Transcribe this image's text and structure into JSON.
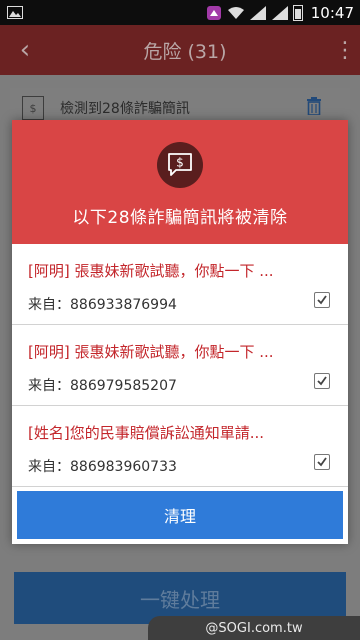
{
  "status_bar": {
    "time": "10:47",
    "icons": [
      "image-icon",
      "notification-icon",
      "wifi-icon",
      "signal-icon",
      "signal-icon",
      "battery-icon"
    ]
  },
  "app_bar": {
    "back_icon": "‹",
    "title": "危险 (31)",
    "more_icon": "⋮"
  },
  "background_list": {
    "card_text": "檢測到28條詐騙簡訊",
    "button_label": "一键处理"
  },
  "modal": {
    "title": "以下28條詐騙簡訊將被清除",
    "badge_icon": "sms-money-icon",
    "messages": [
      {
        "text": "[阿明] 張惠妹新歌試聽，你點一下 ...",
        "from": "来自：886933876994",
        "checked": true
      },
      {
        "text": "[阿明] 張惠妹新歌試聽，你點一下 ...",
        "from": "来自：886979585207",
        "checked": true
      },
      {
        "text": "[姓名]您的民事賠償訴訟通知單請...",
        "from": "来自：886983960733",
        "checked": true
      }
    ],
    "clean_button": "清理"
  },
  "colors": {
    "header_red": "#d94545",
    "message_red": "#c3262b",
    "button_blue": "#2f7bd9"
  },
  "watermark": "@SOGI.com.tw"
}
